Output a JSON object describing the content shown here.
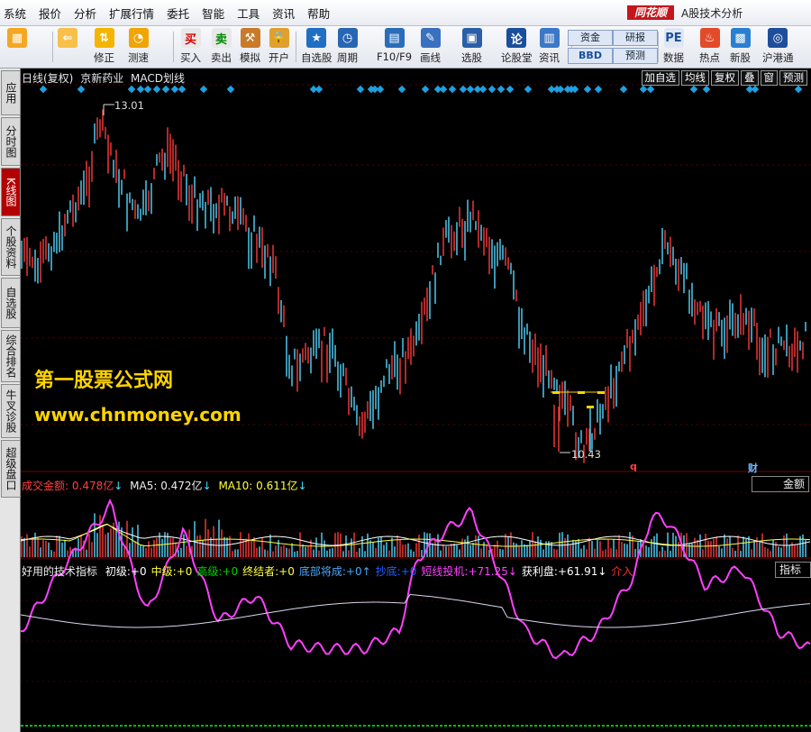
{
  "menu": [
    "系统",
    "报价",
    "分析",
    "扩展行情",
    "委托",
    "智能",
    "工具",
    "资讯",
    "帮助"
  ],
  "brand": {
    "logo": "同花顺",
    "title": "A股技术分析"
  },
  "toolbar": [
    {
      "label": "",
      "icon": "windows-icon"
    },
    {
      "label": "",
      "icon": "back-arrow-icon"
    },
    {
      "label": "修正",
      "icon": "up-down-arrow-icon"
    },
    {
      "label": "测速",
      "icon": "speed-icon"
    },
    {
      "label": "买入",
      "icon": "buy-icon",
      "glyph": "买"
    },
    {
      "label": "卖出",
      "icon": "sell-icon",
      "glyph": "卖"
    },
    {
      "label": "模拟",
      "icon": "hammer-icon"
    },
    {
      "label": "开户",
      "icon": "lock-icon"
    },
    {
      "label": "自选股",
      "icon": "star-icon"
    },
    {
      "label": "周期",
      "icon": "clock-icon"
    },
    {
      "label": "F10/F9",
      "icon": "f10-icon"
    },
    {
      "label": "画线",
      "icon": "pencil-icon"
    },
    {
      "label": "选股",
      "icon": "screen-icon"
    },
    {
      "label": "论股堂",
      "icon": "forum-icon",
      "glyph": "论"
    },
    {
      "label": "资讯",
      "icon": "news-icon"
    },
    {
      "label": "数据",
      "icon": "pe-icon",
      "glyph": "PE"
    },
    {
      "label": "热点",
      "icon": "hot-icon"
    },
    {
      "label": "新股",
      "icon": "new-stock-icon"
    },
    {
      "label": "沪港通",
      "icon": "sse-hke-icon"
    }
  ],
  "toolbar_pairs": {
    "fund": "资金",
    "bbd": "BBD",
    "research": "研报",
    "forecast": "预测"
  },
  "sidebar": [
    "应用",
    "分时图",
    "K线图",
    "个股资料",
    "自选股",
    "综合排名",
    "牛叉诊股",
    "超级盘口"
  ],
  "kline": {
    "period": "日线(复权)",
    "stock": "京新药业",
    "indicator": "MACD划线",
    "high_label": "13.01",
    "low_label": "10.43",
    "marker_q": "q",
    "marker_cai": "财",
    "buttons": [
      "加自选",
      "均线",
      "复权",
      "叠",
      "窗",
      "预测"
    ],
    "colors": {
      "up": "#ff3b3b",
      "down": "#54d7ff",
      "diamond": "#1fa0e0"
    }
  },
  "watermark": {
    "line1": "第一股票公式网",
    "line2": "www.chnmoney.com"
  },
  "volume": {
    "label": "成交金额:",
    "value": "0.478亿",
    "ma5_label": "MA5:",
    "ma5": "0.472亿",
    "ma10_label": "MA10:",
    "ma10": "0.611亿",
    "tag": "金额"
  },
  "indicator_panel": {
    "name": "好用的技术指标",
    "items": [
      {
        "label": "初级:",
        "value": "+0",
        "color": "#ffffff"
      },
      {
        "label": "中级:",
        "value": "+0",
        "color": "#ffff40"
      },
      {
        "label": "高级:",
        "value": "+0",
        "color": "#00d000"
      },
      {
        "label": "终结者:",
        "value": "+0",
        "color": "#ffff40"
      },
      {
        "label": "底部将成:",
        "value": "+0↑",
        "color": "#4aa8ff"
      },
      {
        "label": "抄底:",
        "value": "+0",
        "color": "#2060ff"
      },
      {
        "label": "短线投机:",
        "value": "+71.25↓",
        "color": "#ff40ff"
      },
      {
        "label": "获利盘:",
        "value": "+61.91↓",
        "color": "#ffffff"
      },
      {
        "label": "介入",
        "value": "",
        "color": "#ff3030"
      }
    ],
    "tag": "指标"
  }
}
